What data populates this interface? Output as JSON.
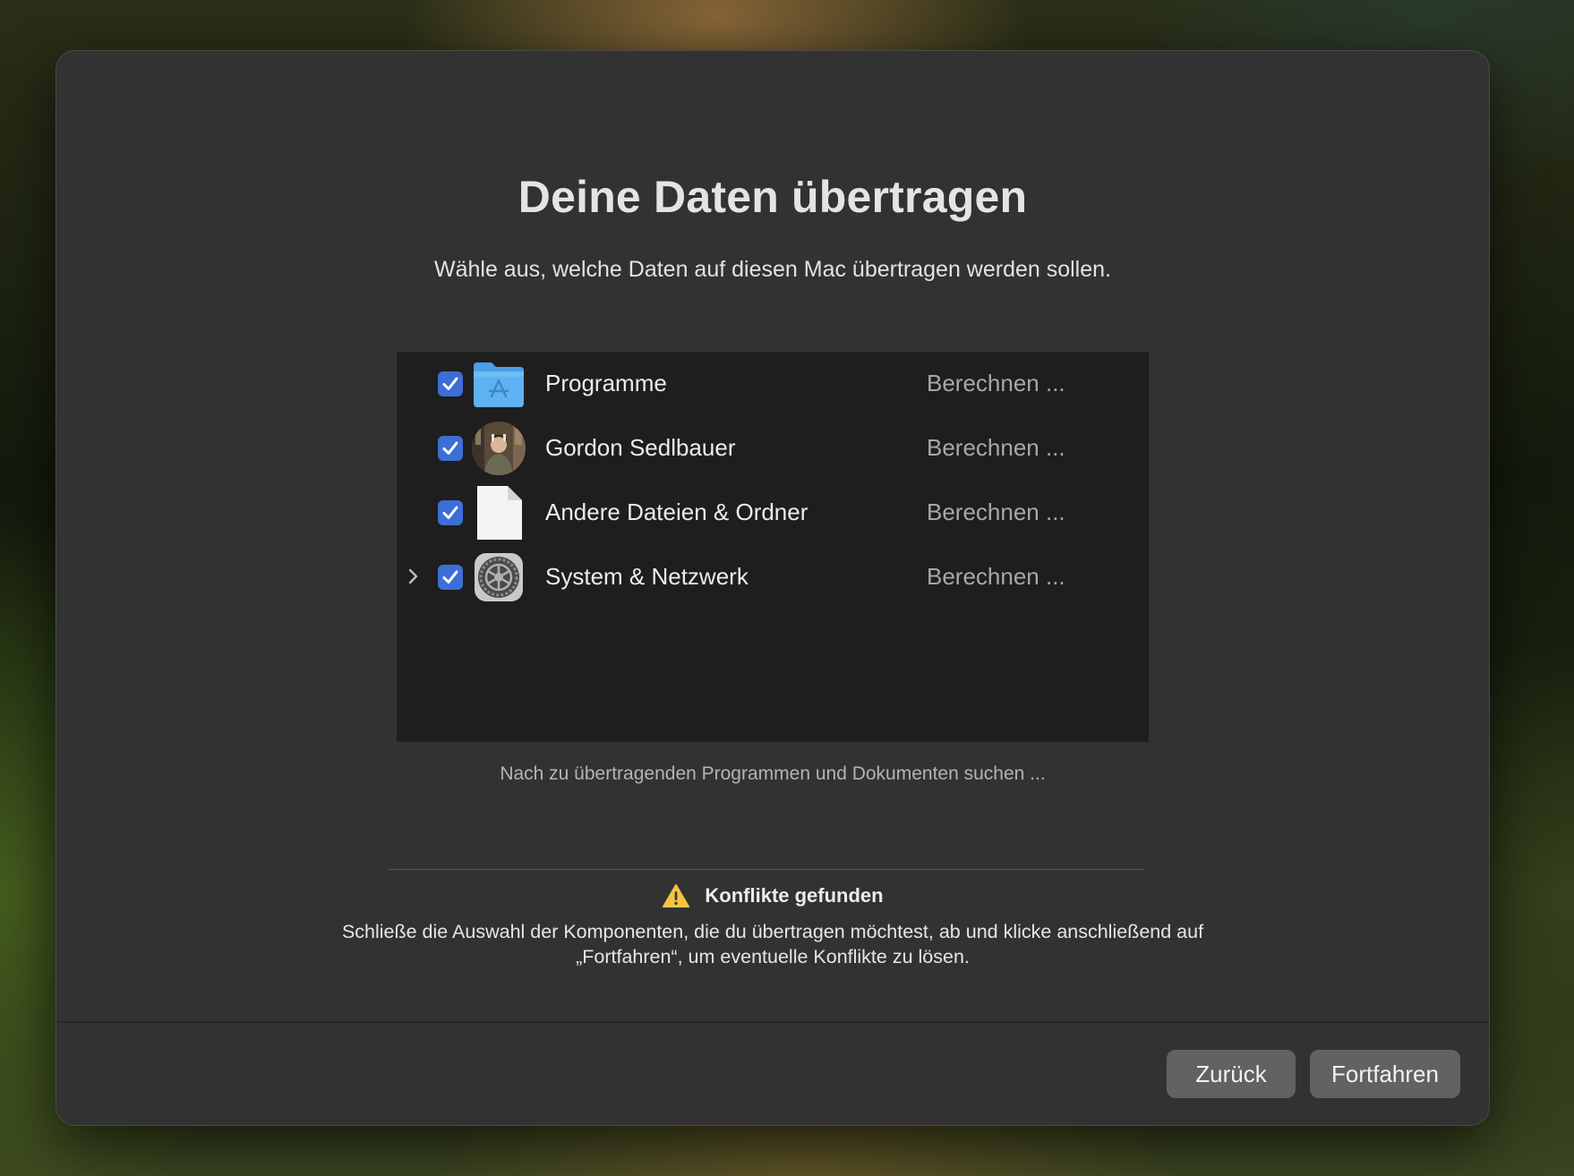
{
  "dialog": {
    "title": "Deine Daten übertragen",
    "subtitle": "Wähle aus, welche Daten auf diesen Mac übertragen werden sollen."
  },
  "items": [
    {
      "label": "Programme",
      "status": "Berechnen ...",
      "checked": true,
      "icon": "applications-folder-icon",
      "expandable": false
    },
    {
      "label": "Gordon Sedlbauer",
      "status": "Berechnen ...",
      "checked": true,
      "icon": "user-avatar-icon",
      "expandable": false
    },
    {
      "label": "Andere Dateien & Ordner",
      "status": "Berechnen ...",
      "checked": true,
      "icon": "document-icon",
      "expandable": false
    },
    {
      "label": "System & Netzwerk",
      "status": "Berechnen ...",
      "checked": true,
      "icon": "system-settings-gear-icon",
      "expandable": true
    }
  ],
  "search_note": "Nach zu übertragenden Programmen und Dokumenten suchen ...",
  "conflict": {
    "heading": "Konflikte gefunden",
    "body_line1": "Schließe die Auswahl der Komponenten, die du übertragen möchtest, ab und klicke anschließend auf",
    "body_line2": "„Fortfahren“, um eventuelle Konflikte zu lösen."
  },
  "buttons": {
    "back": "Zurück",
    "next": "Fortfahren"
  },
  "colors": {
    "checkbox": "#3d6ed6",
    "window": "#323232",
    "list_bg": "#1e1e1e",
    "button": "#626262",
    "warning": "#f5c542"
  }
}
